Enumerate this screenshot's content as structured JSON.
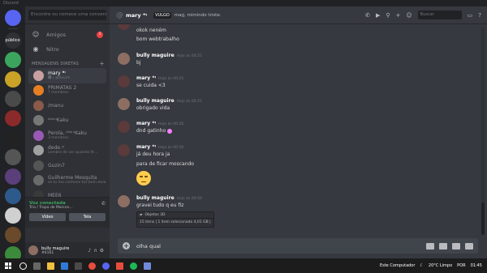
{
  "window": {
    "title": "Discord"
  },
  "guilds": [
    {
      "name": "discord-home",
      "label": "",
      "color": "#5865f2"
    },
    {
      "name": "server-publico",
      "label": "público",
      "color": "#2f3136"
    },
    {
      "name": "server-green",
      "label": "",
      "color": "#3ba55d"
    },
    {
      "name": "server-yellow",
      "label": "",
      "color": "#c9a227"
    },
    {
      "name": "server-eggs",
      "label": "",
      "color": "#4a4a4a"
    },
    {
      "name": "server-red",
      "label": "",
      "color": "#8b2a2a"
    },
    {
      "name": "server-dark",
      "label": "",
      "color": "#222222"
    },
    {
      "name": "server-gray",
      "label": "",
      "color": "#555555"
    },
    {
      "name": "server-purple",
      "label": "",
      "color": "#5a3f7a"
    },
    {
      "name": "server-blue",
      "label": "",
      "color": "#2d5a8a"
    },
    {
      "name": "server-white",
      "label": "",
      "color": "#d0d0d0"
    },
    {
      "name": "server-brown",
      "label": "",
      "color": "#6a4a2a"
    },
    {
      "name": "server-green2",
      "label": "",
      "color": "#3c8a3c"
    },
    {
      "name": "server-pink",
      "label": "",
      "color": "#a23c8a"
    }
  ],
  "sidebar": {
    "search_placeholder": "Encontre ou comece uma conversa",
    "nav": [
      {
        "label": "Amigos",
        "badge": "1"
      },
      {
        "label": "Nitro",
        "badge": ""
      }
    ],
    "dm_header": "MENSAGENS DIRETAS",
    "dm_add": "+",
    "dms": [
      {
        "name": "mary ❝ᵎ",
        "sub": "🅓 | @daynk",
        "color": "#c9a0a0",
        "active": true
      },
      {
        "name": "PRIMATAS 2",
        "sub": "7 membros",
        "color": "#e67e22",
        "active": false
      },
      {
        "name": "/manu",
        "sub": "",
        "color": "#8a5a4a",
        "active": false
      },
      {
        "name": "ᵎᴷᵃᵏᵘKaku",
        "sub": "",
        "color": "#777777",
        "active": false
      },
      {
        "name": "Perola, ᵎᴷᵃᵏᵘKaku",
        "sub": "3 membros",
        "color": "#9b59b6",
        "active": false
      },
      {
        "name": "dede.ᵎᵎᵎ",
        "sub": "Lembre de ver quando th...",
        "color": "#a0a0a0",
        "active": false
      },
      {
        "name": "Guzin7",
        "sub": "",
        "color": "#555555",
        "active": false
      },
      {
        "name": "Guilherme Mesquita",
        "sub": "se tu me conhece tas bem essa...",
        "color": "#6a6a6a",
        "active": false
      },
      {
        "name": "MEE6",
        "sub": "",
        "color": "#3a3a3a",
        "active": false
      }
    ],
    "voice": {
      "status": "Voz conectada",
      "location": "Trio / Tropa de Marcon...",
      "video_label": "Vídeo",
      "screen_label": "Tela"
    },
    "user": {
      "name": "bully maguire",
      "tag": "#6161"
    }
  },
  "header": {
    "channel": "mary ❝ᵎ",
    "tag": "VULGO",
    "status": "mag, mimindo triste.",
    "search_placeholder": "Buscar"
  },
  "messages": {
    "lines_top": [
      "okok neném",
      "bom webtrabalho"
    ],
    "groups": [
      {
        "author": "bully maguire",
        "time": "Hoje às 00:25",
        "lines": [
          "bj"
        ]
      },
      {
        "author": "mary ❝ᵎ",
        "time": "Hoje às 00:25",
        "lines": [
          "se cuida <3"
        ]
      },
      {
        "author": "bully maguire",
        "time": "Hoje às 00:25",
        "lines": [
          "obrigado vida"
        ]
      },
      {
        "author": "mary ❝ᵎ",
        "time": "Hoje às 00:26",
        "lines": [
          "dnd gatinho"
        ]
      },
      {
        "author": "mary ❝ᵎ",
        "time": "Hoje às 00:50",
        "lines": [
          "já deu hora ja",
          "para de ficar moscando"
        ]
      },
      {
        "author": "bully maguire",
        "time": "Hoje às 00:50",
        "lines": [
          "gravei tudo q eu fiz"
        ]
      }
    ],
    "attachment": {
      "title": "Objetos 3D",
      "details": "15 itens | 1 item selecionado 4,01 GB |"
    }
  },
  "composer": {
    "value": "olha qual"
  },
  "taskbar": {
    "tray_label": "Este Computador",
    "weather": "20°C Limpo",
    "lang": "POR",
    "time": "01:45"
  }
}
